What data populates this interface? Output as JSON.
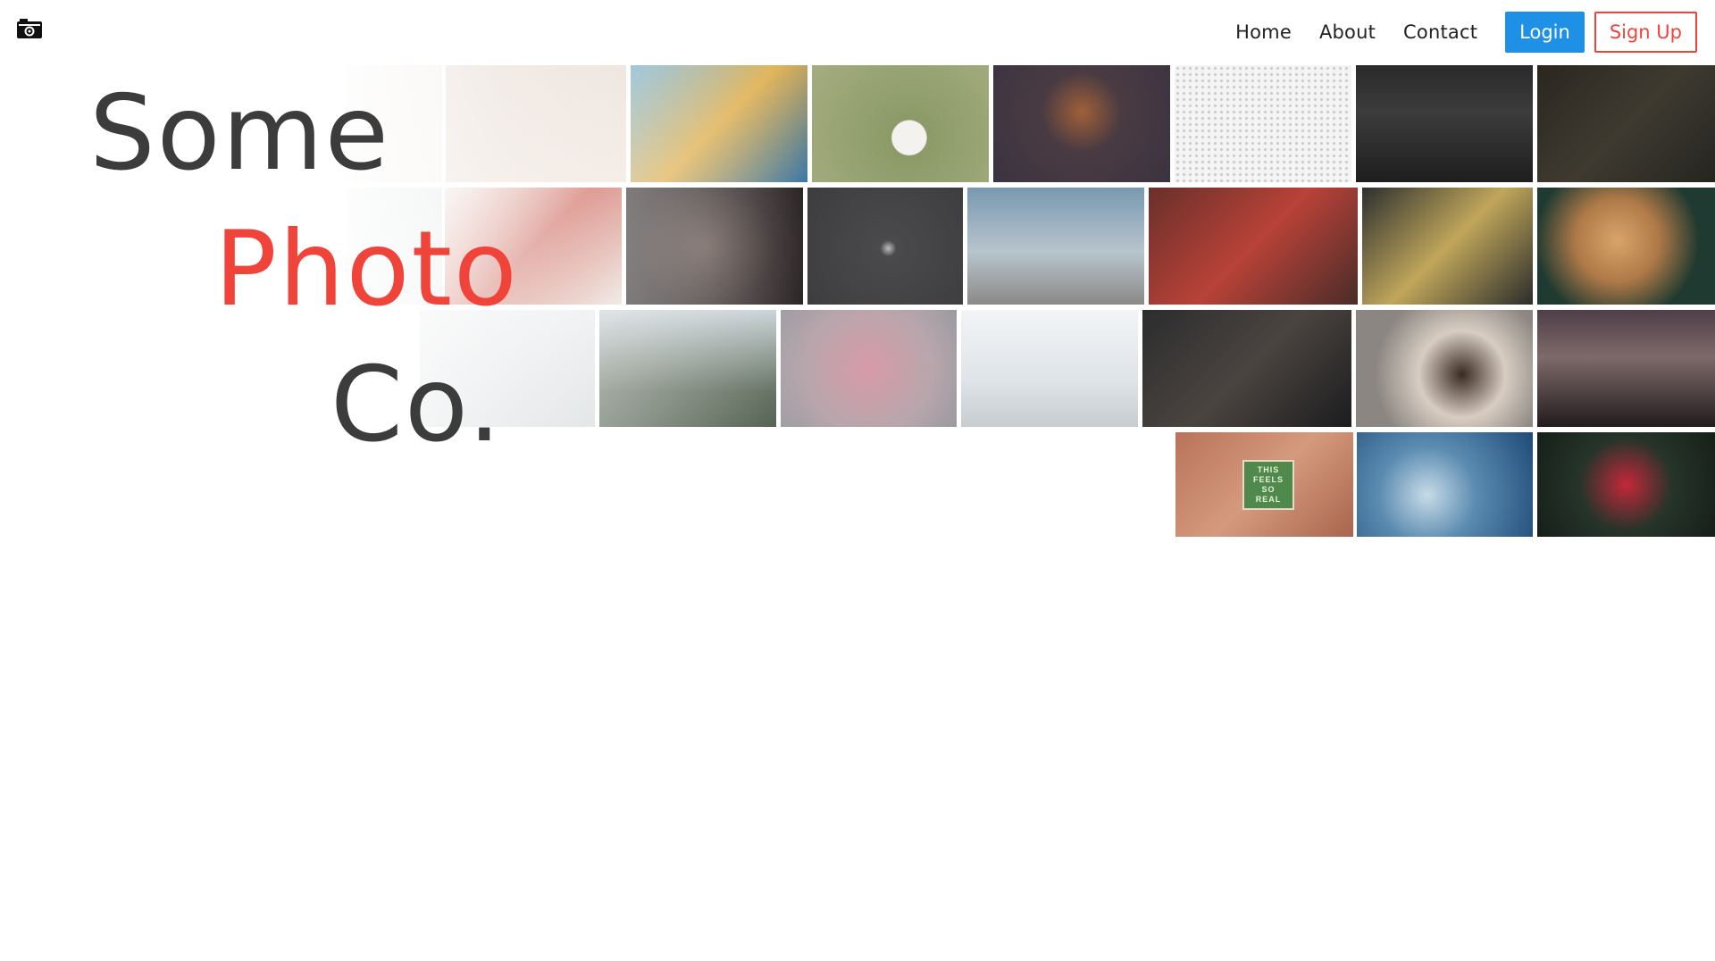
{
  "brand": {
    "logo_icon": "camera-icon"
  },
  "nav": {
    "links": [
      "Home",
      "About",
      "Contact"
    ],
    "login_label": "Login",
    "signup_label": "Sign Up"
  },
  "hero": {
    "word1": "Some",
    "word2": "Photo",
    "word3": "Co."
  },
  "colors": {
    "accent_red": "#f0443b",
    "accent_blue": "#1e90e6",
    "text_dark": "#3c3c3c"
  },
  "gallery": {
    "sign_text": [
      "THIS",
      "FEELS",
      "SO",
      "REAL"
    ],
    "photos": [
      {
        "name": "photo-blurred-light",
        "bg": "linear-gradient(135deg,#e9e2dc,#f3ece6)"
      },
      {
        "name": "photo-cozy-blanket",
        "bg": "linear-gradient(135deg,#d8c6b8,#efe3da)"
      },
      {
        "name": "photo-colorful-mural",
        "bg": "linear-gradient(135deg,#6aa8c8,#e0b050,#3b78a8)"
      },
      {
        "name": "photo-coffee-on-grass",
        "bg": "radial-gradient(circle at 55% 62%,#f4f2ee 0,#f4f2ee 14%,#8c9a68 15%,#a5ad80 100%)"
      },
      {
        "name": "photo-vintage-lamp",
        "bg": "radial-gradient(circle at 50% 40%,#a06038 0,#4a3b42 35%,#3a3340 100%)"
      },
      {
        "name": "photo-speckled-texture",
        "bg": "radial-gradient(circle,#c8c8c8 1px,#f4f4f4 2px)"
      },
      {
        "name": "photo-car-headlights",
        "bg": "linear-gradient(180deg,#2a2a2a,#3c3c3c 40%,#1e1e1e)"
      },
      {
        "name": "photo-aerial-forest",
        "bg": "linear-gradient(135deg,#2b2620,#3e3a30,#252520)"
      },
      {
        "name": "photo-fog-tree",
        "bg": "linear-gradient(135deg,#cfd6d8,#e6eaeb)"
      },
      {
        "name": "photo-gift-wrap",
        "bg": "linear-gradient(135deg,#e8ddd4,#c44a3c,#e8e0d8)"
      },
      {
        "name": "photo-woman-portrait",
        "bg": "radial-gradient(circle at 45% 50%,#6a5a55 0,#3a3232 60%,#2a2424 100%)"
      },
      {
        "name": "photo-dark-eclipse",
        "bg": "radial-gradient(circle at 52% 52%,#bdbdbd 0,#4a4a4c 8%,#3d3d40 100%)"
      },
      {
        "name": "photo-string-lights-palm",
        "bg": "linear-gradient(180deg,#7898b0,#b7c4cd 55%,#8a8a86)"
      },
      {
        "name": "photo-red-temple",
        "bg": "linear-gradient(135deg,#6a2f2a,#b84238,#4a2c28)"
      },
      {
        "name": "photo-dragon-mural",
        "bg": "linear-gradient(135deg,#2d3030,#c0a65a,#2b2d2c)"
      },
      {
        "name": "photo-baked-dish",
        "bg": "radial-gradient(circle at 45% 45%,#d9a46a 0,#b07a48 35%,#1f3a30 70%)"
      },
      {
        "name": "photo-misty-surfer",
        "bg": "linear-gradient(180deg,#e6e8ea,#cdd2d4)"
      },
      {
        "name": "photo-man-white-jacket",
        "bg": "linear-gradient(180deg,#c8d2d6,#5d6a5a 70%,#4a5a48)"
      },
      {
        "name": "photo-pink-hand",
        "bg": "radial-gradient(circle at 50% 50%,#d79aa8 0,#b8a6ac 60%,#9a9aa0)"
      },
      {
        "name": "photo-snowy-town",
        "bg": "linear-gradient(180deg,#f2f4f6,#dfe4e8 60%,#c6ccd0)"
      },
      {
        "name": "photo-dark-porch",
        "bg": "linear-gradient(135deg,#2c2c2e,#4a4440,#1c1c1e)"
      },
      {
        "name": "photo-donut-plate",
        "bg": "radial-gradient(circle at 60% 55%,#3a2a22 0,#d8cdc2 35%,#8b8681 70%)"
      },
      {
        "name": "photo-city-night",
        "bg": "linear-gradient(180deg,#4e3e48,#7e6a6a 40%,#231c1e)"
      },
      {
        "name": "photo-this-feels-so-real",
        "bg": "linear-gradient(135deg,#b8735a,#d59a7d,#a9654e)"
      },
      {
        "name": "photo-snow-bokeh",
        "bg": "radial-gradient(circle at 40% 60%,#c8dbe8 0,#5a8bb0 40%,#1f4a78)"
      },
      {
        "name": "photo-red-berries",
        "bg": "radial-gradient(circle at 50% 50%,#c3283a 0,#26342a 45%,#151f18)"
      }
    ]
  }
}
